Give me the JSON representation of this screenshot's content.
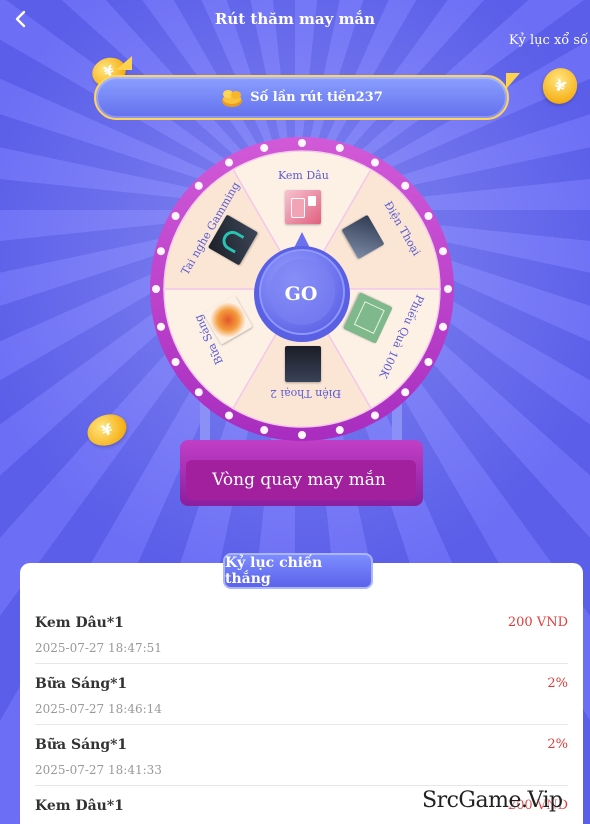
{
  "header": {
    "title": "Rút thăm may mắn",
    "record_link": "Kỷ lục xổ số"
  },
  "draws": {
    "label": "Số lần rút tiền237"
  },
  "wheel": {
    "go_label": "GO",
    "name": "Vòng quay may mắn",
    "prizes": [
      {
        "label": "Kem Dâu",
        "image": "strawberry-milk-tea"
      },
      {
        "label": "Điện Thoại",
        "image": "phone-box"
      },
      {
        "label": "Phiếu Quà 100K",
        "image": "gift-voucher"
      },
      {
        "label": "Điện Thoại 2",
        "image": "phone-box-2"
      },
      {
        "label": "Bữa Sáng",
        "image": "breakfast-dish"
      },
      {
        "label": "Tai nghe Gamming",
        "image": "gaming-headset"
      }
    ]
  },
  "records": {
    "title": "Kỷ lục chiến thắng",
    "items": [
      {
        "name": "Kem Dâu*1",
        "time": "2025-07-27 18:47:51",
        "amount": "200 VND"
      },
      {
        "name": "Bữa Sáng*1",
        "time": "2025-07-27 18:46:14",
        "amount": "2%"
      },
      {
        "name": "Bữa Sáng*1",
        "time": "2025-07-27 18:41:33",
        "amount": "2%"
      },
      {
        "name": "Kem Dâu*1",
        "time": "",
        "amount": "200 VND"
      }
    ]
  },
  "watermark": "SrcGame.Vip",
  "colors": {
    "background": "#5f63f0",
    "wheel_rim": "#c63fd0",
    "segment_light": "#fdf1e6",
    "segment_peach": "#fbe6d6",
    "go_button": "#6e74f0",
    "amount_red": "#e23b3b",
    "banner_border": "#ffd45a"
  },
  "icons": {
    "back": "chevron-left-icon",
    "coin": "yuan-coin-icon",
    "coin_bag": "coin-bag-icon"
  }
}
